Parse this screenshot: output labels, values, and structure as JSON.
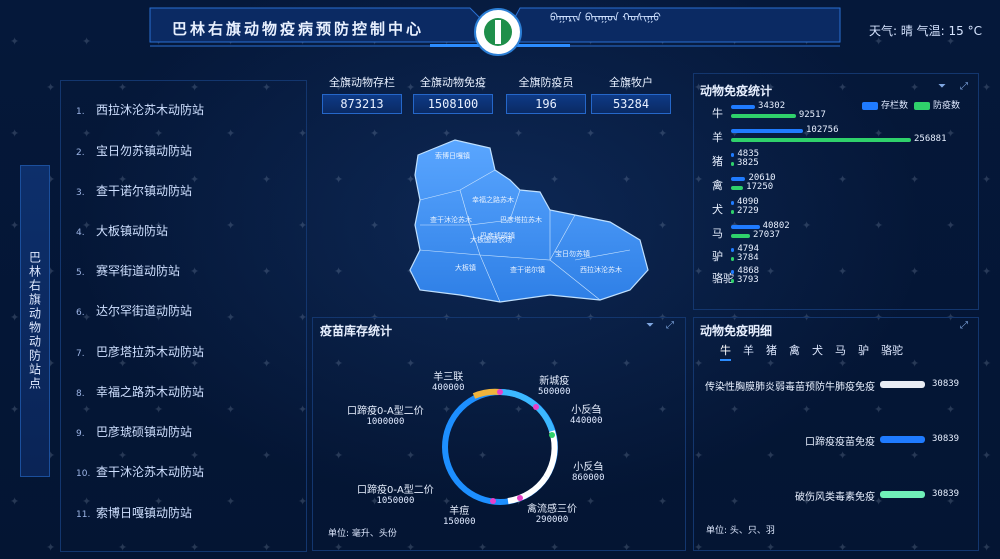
{
  "header": {
    "title": "巴林右旗动物疫病预防控制中心",
    "mongol_text": "ᠪᠠᠭᠠᠷᠢᠨ ᠪᠠᠷᠠᠭᠤᠨ ᠬᠣᠰᠢᠭᠤ",
    "weather": "天气: 晴  气温: 15 °C"
  },
  "left": {
    "tab_label": "巴林右旗动物动防站点",
    "stations": [
      {
        "no": "1.",
        "name": "西拉沐沦苏木动防站"
      },
      {
        "no": "2.",
        "name": "宝日勿苏镇动防站"
      },
      {
        "no": "3.",
        "name": "查干诺尔镇动防站"
      },
      {
        "no": "4.",
        "name": "大板镇动防站"
      },
      {
        "no": "5.",
        "name": "赛罕街道动防站"
      },
      {
        "no": "6.",
        "name": "达尔罕街道动防站"
      },
      {
        "no": "7.",
        "name": "巴彦塔拉苏木动防站"
      },
      {
        "no": "8.",
        "name": "幸福之路苏木动防站"
      },
      {
        "no": "9.",
        "name": "巴彦琥硕镇动防站"
      },
      {
        "no": "10.",
        "name": "查干沐沦苏木动防站"
      },
      {
        "no": "11.",
        "name": "索博日嘎镇动防站"
      }
    ]
  },
  "stats": [
    {
      "label": "全旗动物存栏",
      "value": "873213"
    },
    {
      "label": "全旗动物免疫",
      "value": "1508100"
    },
    {
      "label": "全旗防疫员",
      "value": "196"
    },
    {
      "label": "全旗牧户",
      "value": "53284"
    }
  ],
  "map_labels": [
    "索博日嘎镇",
    "幸福之路苏木",
    "巴彦琥硕镇",
    "查干沐沦苏木",
    "巴彦塔拉苏木",
    "大板镇",
    "大板国营农场",
    "查干诺尔镇",
    "宝日勿苏镇",
    "西拉沐沦苏木"
  ],
  "immunity": {
    "title": "动物免疫统计",
    "legend": [
      "存栏数",
      "防疫数"
    ],
    "colors": {
      "stock": "#1f7bff",
      "vaccinated": "#2fd16b"
    },
    "chart_data": {
      "type": "bar",
      "categories": [
        "牛",
        "羊",
        "猪",
        "禽",
        "犬",
        "马",
        "驴",
        "骆驼"
      ],
      "series": [
        {
          "name": "存栏数",
          "values": [
            34302,
            102756,
            4835,
            20610,
            4090,
            40802,
            4794,
            4868
          ]
        },
        {
          "name": "防疫数",
          "values": [
            92517,
            256881,
            3825,
            17250,
            2729,
            27037,
            3784,
            3793
          ]
        }
      ],
      "title": "动物免疫统计"
    }
  },
  "vaccine": {
    "title": "疫苗库存统计",
    "unit": "单位: 毫升、头份",
    "items": [
      {
        "name": "新城疫",
        "value": "500000"
      },
      {
        "name": "小反刍",
        "value": "440000"
      },
      {
        "name": "小反刍",
        "value": "860000"
      },
      {
        "name": "禽流感三价",
        "value": "290000"
      },
      {
        "name": "羊痘",
        "value": "150000"
      },
      {
        "name": "口蹄疫0-A型二价",
        "value": "1050000"
      },
      {
        "name": "口蹄疫0-A型二价",
        "value": "1000000"
      },
      {
        "name": "羊三联",
        "value": "400000"
      }
    ]
  },
  "detail": {
    "title": "动物免疫明细",
    "tabs": [
      "牛",
      "羊",
      "猪",
      "禽",
      "犬",
      "马",
      "驴",
      "骆驼"
    ],
    "rows": [
      {
        "label": "传染性胸膜肺炎弱毒苗预防牛肺疫免疫",
        "value": "30839",
        "color": "#e8ecf3"
      },
      {
        "label": "口蹄疫疫苗免疫",
        "value": "30839",
        "color": "#1f7bff"
      },
      {
        "label": "破伤风类毒素免疫",
        "value": "30839",
        "color": "#6ff0b8"
      }
    ],
    "unit": "单位: 头、只、羽"
  }
}
